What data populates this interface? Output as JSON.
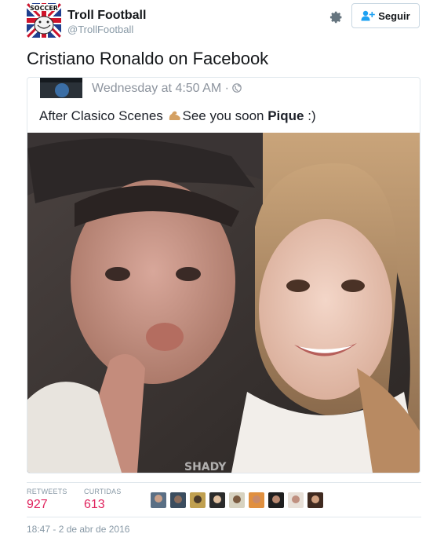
{
  "header": {
    "display_name": "Troll Football",
    "handle": "@TrollFootball",
    "avatar_icon": "troll-face-union-jack-avatar",
    "avatar_text": "SOCCER",
    "follow_label": "Seguir"
  },
  "tweet": {
    "text": "Cristiano Ronaldo on Facebook"
  },
  "card": {
    "timestamp": "Wednesday at 4:50 AM · ",
    "caption_before": "After Clasico Scenes ",
    "caption_middle": "See you soon ",
    "caption_bold": "Pique",
    "caption_after": " :)",
    "watermark": "SHADY"
  },
  "stats": {
    "retweets_label": "RETWEETS",
    "retweets_value": "927",
    "likes_label": "CURTIDAS",
    "likes_value": "613"
  },
  "likers": [
    "liker-1",
    "liker-2",
    "liker-3",
    "liker-4",
    "liker-5",
    "liker-6",
    "liker-7",
    "liker-8",
    "liker-9"
  ],
  "footer": {
    "date": "18:47 - 2 de abr de 2016"
  },
  "colors": {
    "accent": "#e0245e",
    "muted": "#8899a6",
    "border": "#e1e8ed"
  }
}
